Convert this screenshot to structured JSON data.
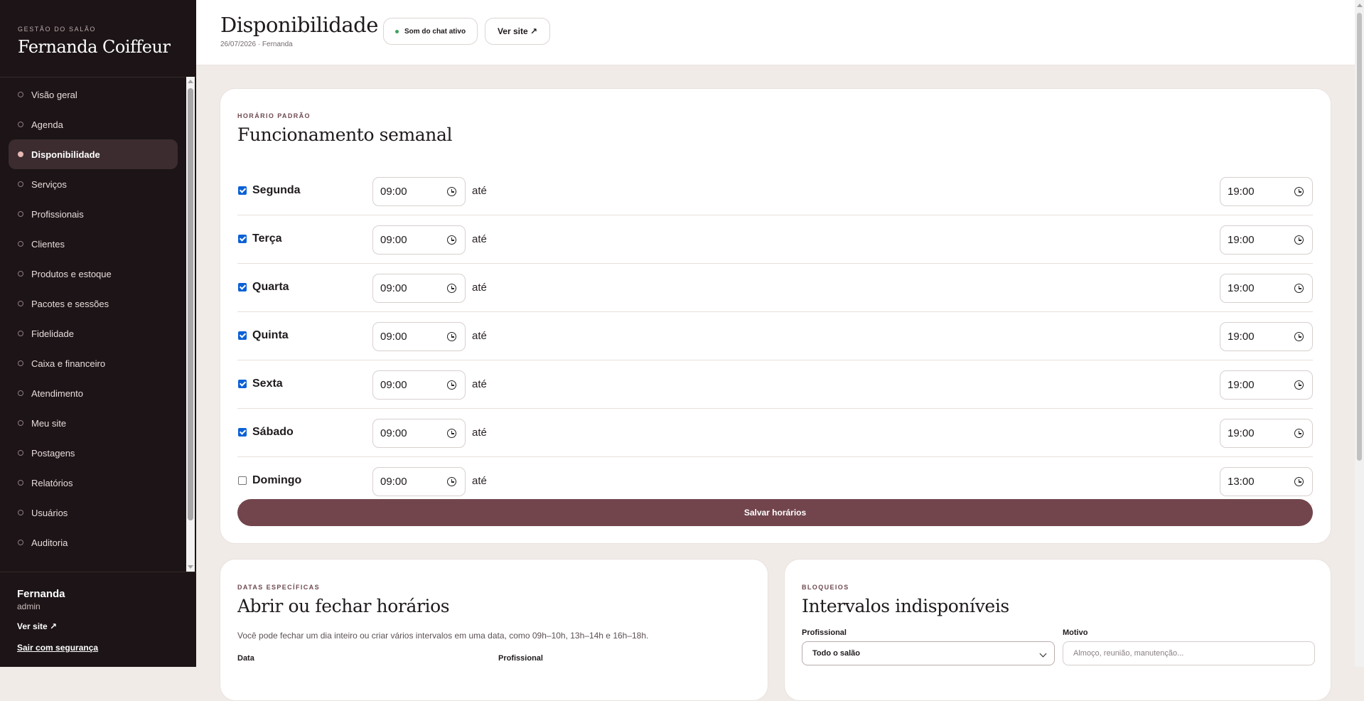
{
  "sidebar": {
    "eyebrow": "GESTÃO DO SALÃO",
    "brand": "Fernanda Coiffeur",
    "items": [
      {
        "label": "Visão geral",
        "active": false
      },
      {
        "label": "Agenda",
        "active": false
      },
      {
        "label": "Disponibilidade",
        "active": true
      },
      {
        "label": "Serviços",
        "active": false
      },
      {
        "label": "Profissionais",
        "active": false
      },
      {
        "label": "Clientes",
        "active": false
      },
      {
        "label": "Produtos e estoque",
        "active": false
      },
      {
        "label": "Pacotes e sessões",
        "active": false
      },
      {
        "label": "Fidelidade",
        "active": false
      },
      {
        "label": "Caixa e financeiro",
        "active": false
      },
      {
        "label": "Atendimento",
        "active": false
      },
      {
        "label": "Meu site",
        "active": false
      },
      {
        "label": "Postagens",
        "active": false
      },
      {
        "label": "Relatórios",
        "active": false
      },
      {
        "label": "Usuários",
        "active": false
      },
      {
        "label": "Auditoria",
        "active": false
      }
    ],
    "user": {
      "name": "Fernanda",
      "role": "admin",
      "site_link": "Ver site ↗",
      "logout": "Sair com segurança"
    }
  },
  "header": {
    "title": "Disponibilidade",
    "subtitle": "26/07/2026 · Fernanda",
    "chat_status": "Som do chat ativo",
    "site_button": "Ver site ↗"
  },
  "weekly": {
    "eyebrow": "HORÁRIO PADRÃO",
    "title": "Funcionamento semanal",
    "separator": "até",
    "days": [
      {
        "day": "Segunda",
        "enabled": true,
        "start": "09:00",
        "end": "19:00"
      },
      {
        "day": "Terça",
        "enabled": true,
        "start": "09:00",
        "end": "19:00"
      },
      {
        "day": "Quarta",
        "enabled": true,
        "start": "09:00",
        "end": "19:00"
      },
      {
        "day": "Quinta",
        "enabled": true,
        "start": "09:00",
        "end": "19:00"
      },
      {
        "day": "Sexta",
        "enabled": true,
        "start": "09:00",
        "end": "19:00"
      },
      {
        "day": "Sábado",
        "enabled": true,
        "start": "09:00",
        "end": "19:00"
      },
      {
        "day": "Domingo",
        "enabled": false,
        "start": "09:00",
        "end": "13:00"
      }
    ],
    "save_label": "Salvar horários"
  },
  "specific_dates": {
    "eyebrow": "DATAS ESPECÍFICAS",
    "title": "Abrir ou fechar horários",
    "description": "Você pode fechar um dia inteiro ou criar vários intervalos em uma data, como 09h–10h, 13h–14h e 16h–18h.",
    "date_label": "Data",
    "professional_label": "Profissional"
  },
  "blocks": {
    "eyebrow": "BLOQUEIOS",
    "title": "Intervalos indisponíveis",
    "professional_label": "Profissional",
    "professional_value": "Todo o salão",
    "reason_label": "Motivo",
    "reason_placeholder": "Almoço, reunião, manutenção..."
  },
  "colors": {
    "sidebar_bg": "#1c1416",
    "accent": "#72454d",
    "page_bg": "#f1ebe8",
    "status_dot": "#3aa35c"
  }
}
